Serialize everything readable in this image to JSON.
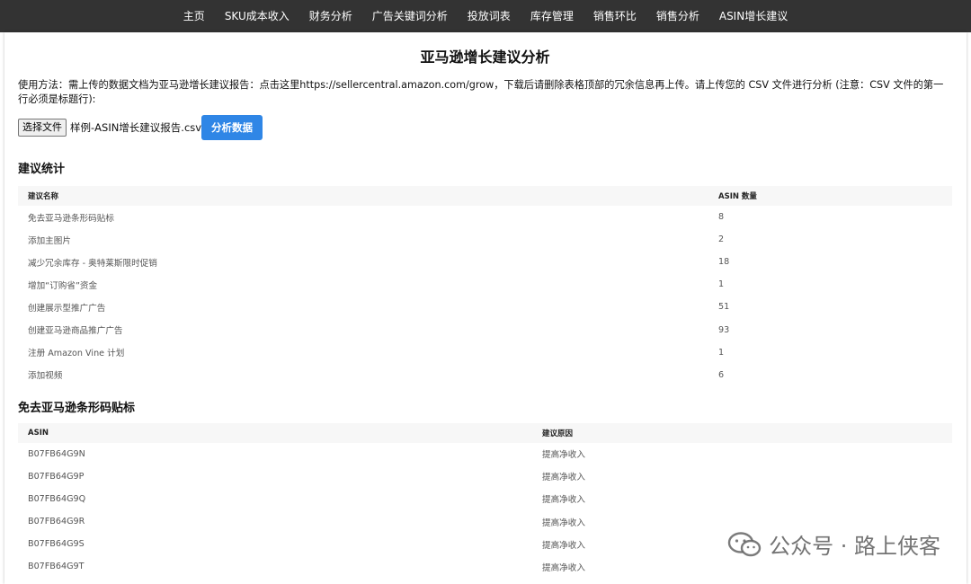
{
  "nav": {
    "items": [
      "主页",
      "SKU成本收入",
      "财务分析",
      "广告关键词分析",
      "投放词表",
      "库存管理",
      "销售环比",
      "销售分析",
      "ASIN增长建议"
    ]
  },
  "page": {
    "title": "亚马逊增长建议分析",
    "instructions": "使用方法：需上传的数据文档为亚马逊增长建议报告：点击这里https://sellercentral.amazon.com/grow，下载后请删除表格顶部的冗余信息再上传。请上传您的 CSV 文件进行分析 (注意：CSV 文件的第一行必须是标题行):"
  },
  "upload": {
    "choose_label": "选择文件",
    "file_name": "样例-ASIN增长建议报告.csv",
    "analyze_label": "分析数据"
  },
  "stats": {
    "title": "建议统计",
    "headers": [
      "建议名称",
      "ASIN 数量"
    ],
    "rows": [
      [
        "免去亚马逊条形码贴标",
        "8"
      ],
      [
        "添加主图片",
        "2"
      ],
      [
        "减少冗余库存 - 奥特莱斯限时促销",
        "18"
      ],
      [
        "增加“订购省”资金",
        "1"
      ],
      [
        "创建展示型推广广告",
        "51"
      ],
      [
        "创建亚马逊商品推广广告",
        "93"
      ],
      [
        "注册 Amazon Vine 计划",
        "1"
      ],
      [
        "添加视频",
        "6"
      ]
    ]
  },
  "detail": {
    "title": "免去亚马逊条形码贴标",
    "headers": [
      "ASIN",
      "建议原因"
    ],
    "rows": [
      [
        "B07FB64G9N",
        "提高净收入"
      ],
      [
        "B07FB64G9P",
        "提高净收入"
      ],
      [
        "B07FB64G9Q",
        "提高净收入"
      ],
      [
        "B07FB64G9R",
        "提高净收入"
      ],
      [
        "B07FB64G9S",
        "提高净收入"
      ],
      [
        "B07FB64G9T",
        "提高净收入"
      ]
    ]
  },
  "watermark": {
    "text": "公众号 · 路上侠客",
    "icon": "wechat-icon"
  }
}
